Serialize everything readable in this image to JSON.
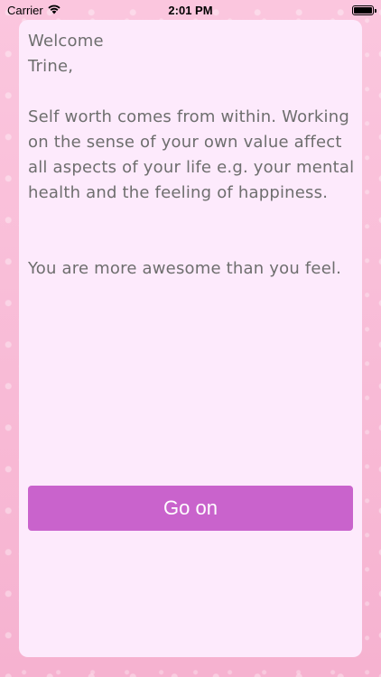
{
  "status_bar": {
    "carrier": "Carrier",
    "time": "2:01 PM",
    "wifi_icon": "wifi-icon",
    "battery_icon": "battery-icon"
  },
  "message": {
    "greeting_line1": "Welcome",
    "greeting_line2": "Trine,",
    "body": "Self worth comes from within. Working on the sense of your own value affect all aspects of your life e.g. your mental health and the feeling of happiness.",
    "closing": "You are more awesome than you feel."
  },
  "actions": {
    "go_on_label": "Go on"
  },
  "colors": {
    "background": "#f8bfd8",
    "card": "#fdeafc",
    "text": "#6e6e6e",
    "button": "#c963cc"
  }
}
